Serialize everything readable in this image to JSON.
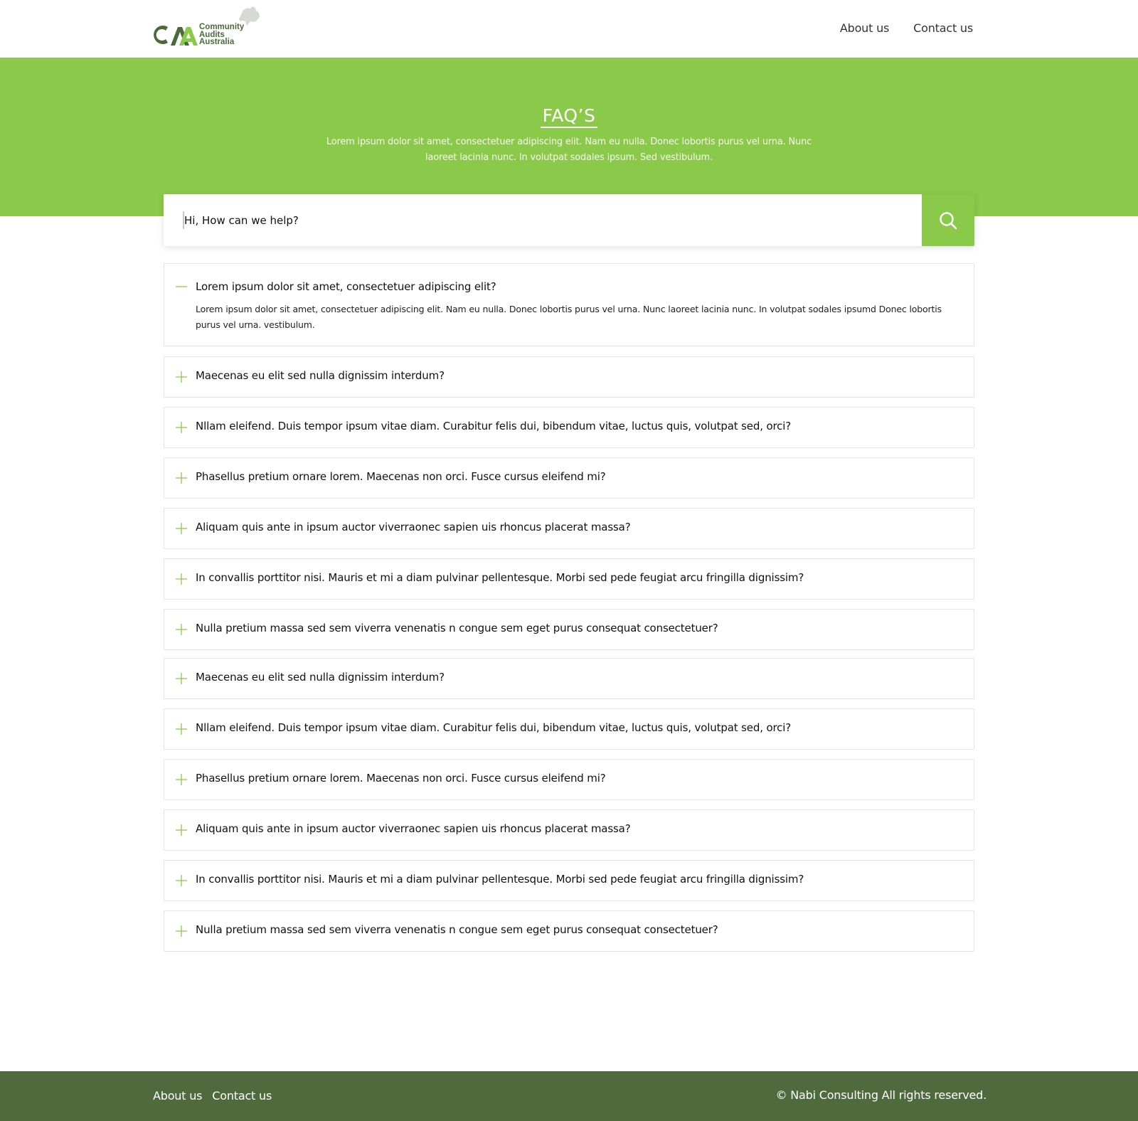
{
  "header": {
    "logo_mark": "CAA",
    "logo_lines": [
      "Community",
      "Audits",
      "Australia"
    ],
    "nav": [
      {
        "label": "About us"
      },
      {
        "label": "Contact us"
      }
    ]
  },
  "hero": {
    "title": "FAQ’S",
    "subtitle": "Lorem ipsum dolor sit amet, consectetuer adipiscing elit. Nam eu nulla. Donec lobortis purus vel urna. Nunc laoreet lacinia nunc. In volutpat sodales ipsum. Sed vestibulum."
  },
  "search": {
    "placeholder": "Hi, How can we help?",
    "icon": "search-icon"
  },
  "faq": [
    {
      "question": "Lorem ipsum dolor sit amet, consectetuer adipiscing elit?",
      "expanded": true,
      "answer": "Lorem ipsum dolor sit amet, consectetuer adipiscing elit. Nam eu nulla. Donec lobortis purus vel urna. Nunc laoreet lacinia nunc. In volutpat sodales ipsumd Donec lobortis purus vel urna. vestibulum."
    },
    {
      "question": "Maecenas eu elit sed nulla dignissim interdum?",
      "expanded": false
    },
    {
      "question": "Nllam eleifend. Duis tempor ipsum vitae diam. Curabitur felis dui, bibendum vitae, luctus quis, volutpat sed, orci?",
      "expanded": false
    },
    {
      "question": "Phasellus pretium ornare lorem. Maecenas non orci. Fusce cursus eleifend mi?",
      "expanded": false
    },
    {
      "question": "Aliquam quis ante in ipsum auctor viverraonec sapien uis rhoncus placerat massa?",
      "expanded": false
    },
    {
      "question": "In convallis porttitor nisi. Mauris et mi a diam pulvinar pellentesque. Morbi sed pede feugiat arcu fringilla dignissim?",
      "expanded": false
    },
    {
      "question": "Nulla pretium massa sed sem viverra venenatis n congue sem eget purus consequat consectetuer?",
      "expanded": false
    },
    {
      "question": "Maecenas eu elit sed nulla dignissim interdum?",
      "expanded": false
    },
    {
      "question": "Nllam eleifend. Duis tempor ipsum vitae diam. Curabitur felis dui, bibendum vitae, luctus quis, volutpat sed, orci?",
      "expanded": false
    },
    {
      "question": "Phasellus pretium ornare lorem. Maecenas non orci. Fusce cursus eleifend mi?",
      "expanded": false
    },
    {
      "question": "Aliquam quis ante in ipsum auctor viverraonec sapien uis rhoncus placerat massa?",
      "expanded": false
    },
    {
      "question": "In convallis porttitor nisi. Mauris et mi a diam pulvinar pellentesque. Morbi sed pede feugiat arcu fringilla dignissim?",
      "expanded": false
    },
    {
      "question": "Nulla pretium massa sed sem viverra venenatis n congue sem eget purus consequat consectetuer?",
      "expanded": false
    }
  ],
  "footer": {
    "nav": [
      {
        "label": "About us"
      },
      {
        "label": "Contact us"
      }
    ],
    "copyright": "© Nabi Consulting All rights reserved."
  },
  "colors": {
    "brand_green": "#8bc94a",
    "footer_green": "#4f6a3d",
    "logo_dark": "#4a6a3a"
  }
}
